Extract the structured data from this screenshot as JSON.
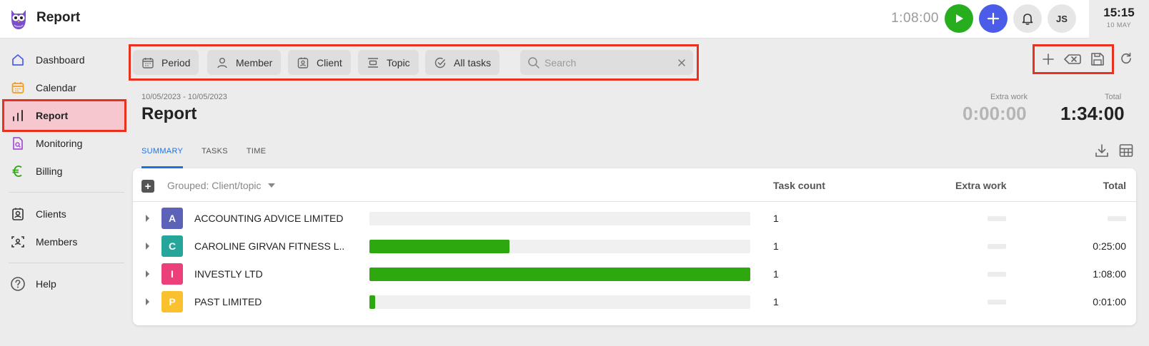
{
  "app": {
    "title": "Report"
  },
  "topbar": {
    "timer": "1:08:00",
    "avatar_initials": "JS",
    "clock_time": "15:15",
    "clock_date": "10 MAY",
    "colors": {
      "play": "#27ae1f",
      "add": "#4a5ce8"
    }
  },
  "sidebar": {
    "items": [
      {
        "label": "Dashboard",
        "icon": "home-icon"
      },
      {
        "label": "Calendar",
        "icon": "calendar-icon"
      },
      {
        "label": "Report",
        "icon": "bar-chart-icon",
        "active": true
      },
      {
        "label": "Monitoring",
        "icon": "monitoring-icon"
      },
      {
        "label": "Billing",
        "icon": "euro-icon"
      },
      {
        "label": "Clients",
        "icon": "clients-icon"
      },
      {
        "label": "Members",
        "icon": "members-icon"
      },
      {
        "label": "Help",
        "icon": "help-icon"
      }
    ]
  },
  "filters": {
    "period": "Period",
    "member": "Member",
    "client": "Client",
    "topic": "Topic",
    "all_tasks": "All tasks",
    "search_placeholder": "Search",
    "search_value": ""
  },
  "header": {
    "date_range": "10/05/2023 - 10/05/2023",
    "title": "Report",
    "extra_work_label": "Extra work",
    "extra_work_value": "0:00:00",
    "total_label": "Total",
    "total_value": "1:34:00"
  },
  "tabs": [
    "SUMMARY",
    "TASKS",
    "TIME"
  ],
  "table": {
    "grouped_label": "Grouped: Client/topic",
    "columns": {
      "task_count": "Task count",
      "extra_work": "Extra work",
      "total": "Total"
    },
    "rows": [
      {
        "letter": "A",
        "badge_color": "#5b62b8",
        "name": "ACCOUNTING ADVICE LIMITED",
        "progress": 0.0,
        "task_count": "1",
        "total": ""
      },
      {
        "letter": "C",
        "badge_color": "#26a59a",
        "name": "CAROLINE GIRVAN FITNESS L...",
        "progress": 0.367,
        "task_count": "1",
        "total": "0:25:00"
      },
      {
        "letter": "I",
        "badge_color": "#ec407a",
        "name": "INVESTLY LTD",
        "progress": 1.0,
        "task_count": "1",
        "total": "1:08:00"
      },
      {
        "letter": "P",
        "badge_color": "#fbc02d",
        "name": "PAST LIMITED",
        "progress": 0.015,
        "task_count": "1",
        "total": "0:01:00"
      }
    ]
  }
}
